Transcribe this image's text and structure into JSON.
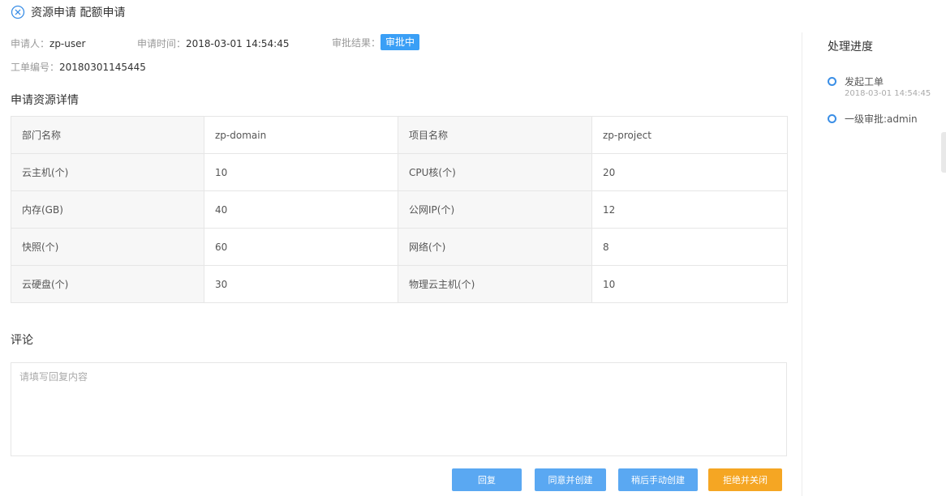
{
  "header": {
    "title": "资源申请 配额申请"
  },
  "meta": {
    "applicant_label": "申请人：",
    "applicant": "zp-user",
    "time_label": "申请时间：",
    "time": "2018-03-01 14:54:45",
    "result_label": "审批结果：",
    "result": "审批中",
    "order_label": "工单编号：",
    "order_no": "20180301145445"
  },
  "details": {
    "title": "申请资源详情",
    "rows": [
      [
        "部门名称",
        "zp-domain",
        "项目名称",
        "zp-project"
      ],
      [
        "云主机(个)",
        "10",
        "CPU核(个)",
        "20"
      ],
      [
        "内存(GB)",
        "40",
        "公网IP(个)",
        "12"
      ],
      [
        "快照(个)",
        "60",
        "网络(个)",
        "8"
      ],
      [
        "云硬盘(个)",
        "30",
        "物理云主机(个)",
        "10"
      ]
    ]
  },
  "comment": {
    "title": "评论",
    "placeholder": "请填写回复内容",
    "value": ""
  },
  "actions": {
    "reply": "回复",
    "approve_create": "同意并创建",
    "manual_create_later": "稍后手动创建",
    "reject_close": "拒绝并关闭"
  },
  "colors": {
    "badge": "#3a9ff6",
    "primary_button": "#5aa8f2",
    "warning_button": "#f5a623",
    "step_dot": "#3a8ee6"
  },
  "progress": {
    "title": "处理进度",
    "steps": [
      {
        "label": "发起工单",
        "time": "2018-03-01 14:54:45"
      },
      {
        "label": "一级审批:admin"
      }
    ]
  },
  "icons": {
    "close": "close-circle-icon",
    "step": "circle-outline-icon"
  }
}
